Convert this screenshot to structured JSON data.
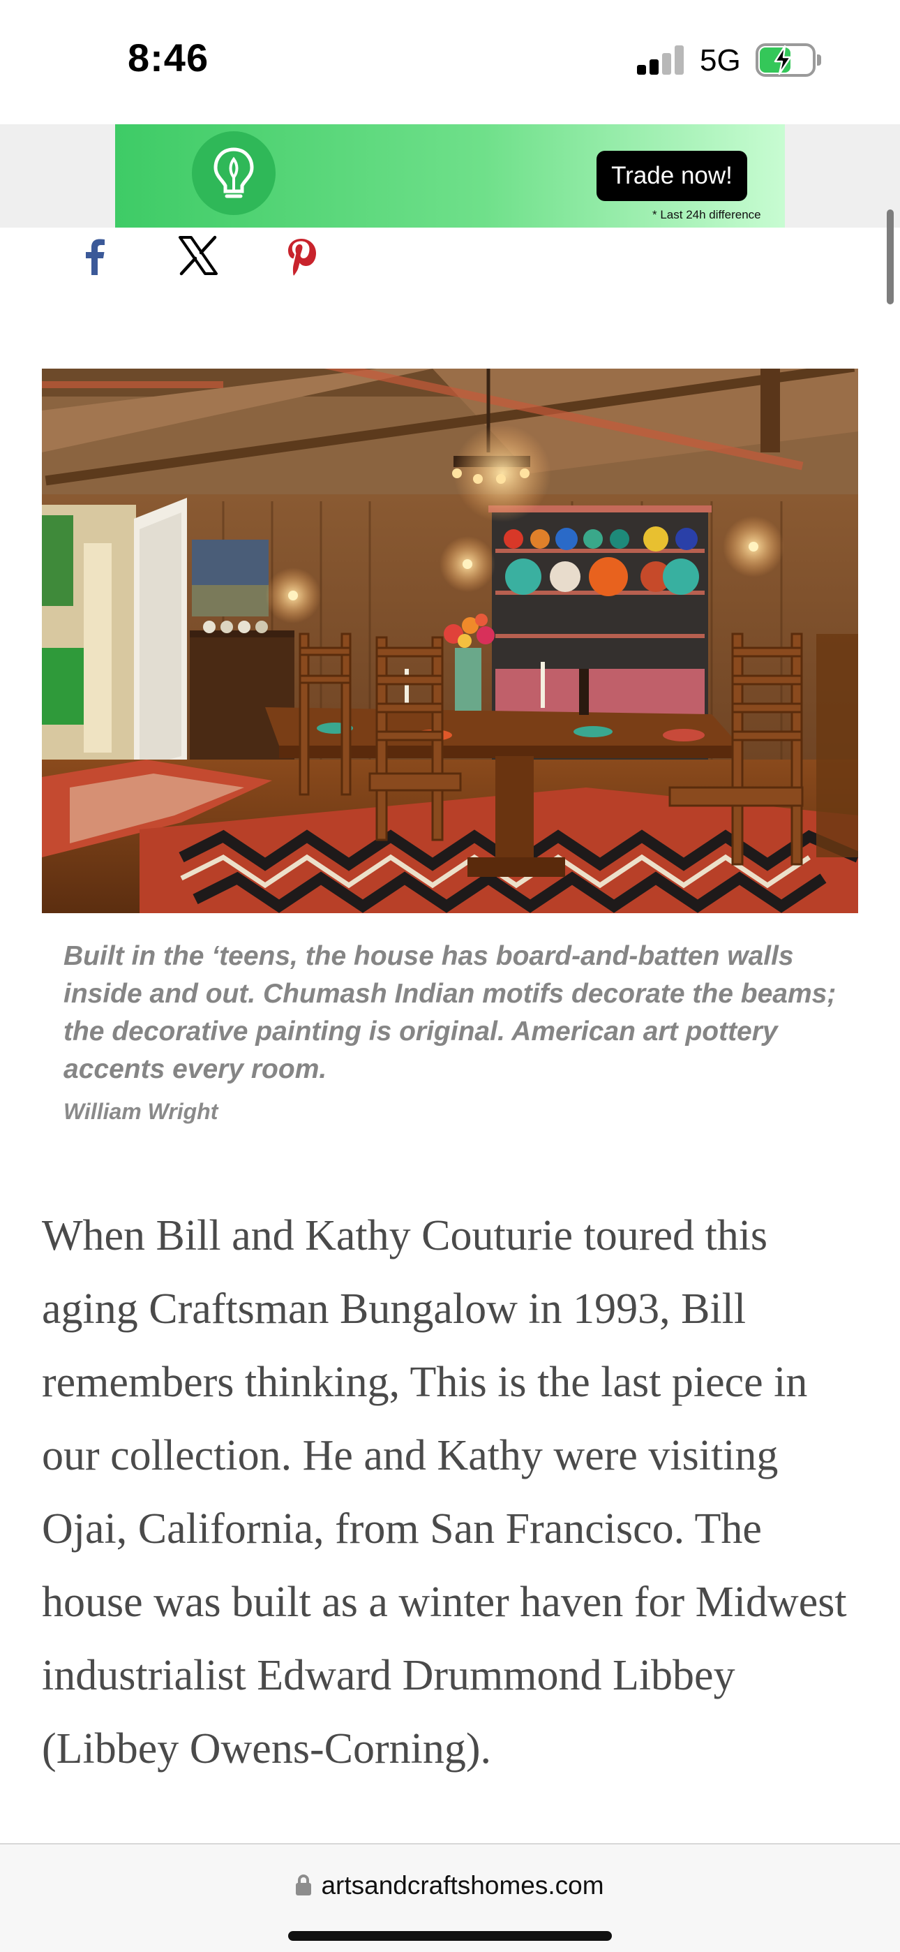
{
  "status_bar": {
    "time": "8:46",
    "network": "5G",
    "signal_bars_active": 2,
    "signal_bars_total": 4,
    "battery_state": "charging"
  },
  "ad": {
    "button_label": "Trade now!",
    "disclaimer": "* Last 24h difference",
    "logo_icon": "lightbulb-icon",
    "colors": {
      "gradient_start": "#3ecb66",
      "gradient_end": "#c8fcd2"
    }
  },
  "share": {
    "icons": [
      "facebook-icon",
      "x-icon",
      "pinterest-icon"
    ],
    "colors": {
      "facebook": "#3b5998",
      "x": "#000000",
      "pinterest": "#c8232c"
    }
  },
  "article": {
    "caption": "Built in the ‘teens, the house has board-and-batten walls inside and out. Chumash Indian motifs decorate the beams; the decorative painting is original. American art pottery accents every room.",
    "photo_credit": "William Wright",
    "body": "When Bill and Kathy Couturie toured this aging Craftsman Bungalow in 1993, Bill remembers thinking, This is the last piece in our collection. He and Kathy were visiting Ojai, California, from San Francisco. The house was built as a winter haven for Midwest industrialist Edward Drummond Libbey (Libbey Owens-Corning)."
  },
  "browser": {
    "url": "artsandcraftshomes.com"
  }
}
